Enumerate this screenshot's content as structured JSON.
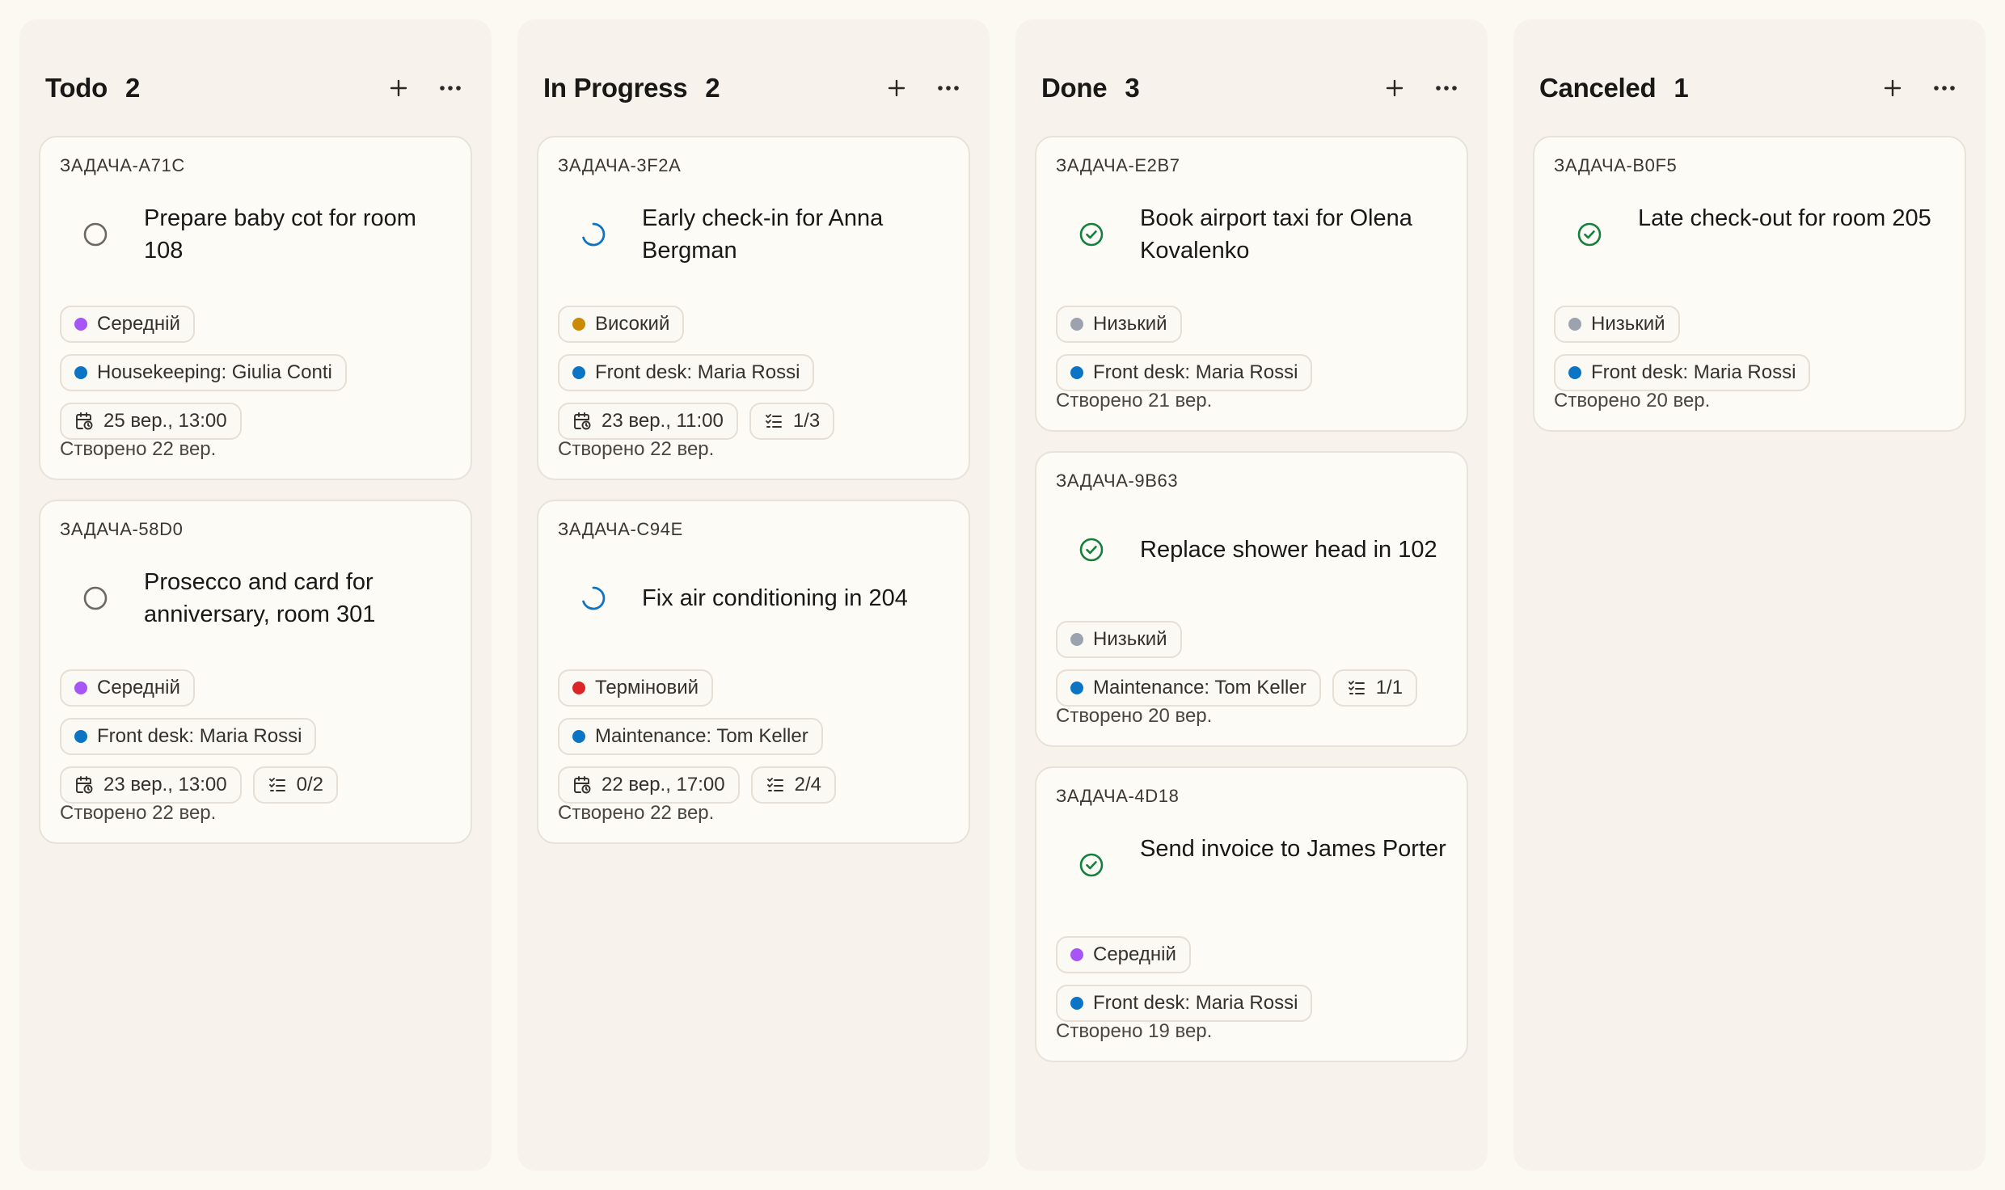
{
  "colors": {
    "background": "#fcf9f3",
    "column_bg": "#f7f3ec",
    "priority_medium": "#a855f7",
    "priority_high": "#ca8a04",
    "priority_urgent": "#dc2626",
    "priority_low": "#9ca3af",
    "assignee_dot": "#0b74c4",
    "in_progress_icon": "#0b74c4",
    "done_icon": "#15803d",
    "todo_icon": "#6b6762"
  },
  "columns": [
    {
      "title": "Todo",
      "count": "2",
      "cards": [
        {
          "id": "ЗАДАЧА-A71C",
          "status_icon": "circle-empty-icon",
          "title": "Prepare baby cot for room 108",
          "priority": "Середній",
          "assignee": "Housekeeping: Giulia Conti",
          "due": "25 вер., 13:00",
          "subtasks": "",
          "created": "Створено 22 вер."
        },
        {
          "id": "ЗАДАЧА-58D0",
          "status_icon": "circle-empty-icon",
          "title": "Prosecco and card for anniversary, room 301",
          "priority": "Середній",
          "assignee": "Front desk: Maria Rossi",
          "due": "23 вер., 13:00",
          "subtasks": "0/2",
          "created": "Створено 22 вер."
        }
      ]
    },
    {
      "title": "In Progress",
      "count": "2",
      "cards": [
        {
          "id": "ЗАДАЧА-3F2A",
          "status_icon": "in-progress-icon",
          "title": "Early check-in for Anna Bergman",
          "priority": "Високий",
          "assignee": "Front desk: Maria Rossi",
          "due": "23 вер., 11:00",
          "subtasks": "1/3",
          "created": "Створено 22 вер."
        },
        {
          "id": "ЗАДАЧА-C94E",
          "status_icon": "in-progress-icon",
          "title": "Fix air conditioning in 204",
          "priority": "Терміновий",
          "assignee": "Maintenance: Tom Keller",
          "due": "22 вер., 17:00",
          "subtasks": "2/4",
          "created": "Створено 22 вер."
        }
      ]
    },
    {
      "title": "Done",
      "count": "3",
      "cards": [
        {
          "id": "ЗАДАЧА-E2B7",
          "status_icon": "check-circle-icon",
          "title": "Book airport taxi for Olena Kovalenko",
          "priority": "Низький",
          "assignee": "Front desk: Maria Rossi",
          "due": "",
          "subtasks": "",
          "created": "Створено 21 вер."
        },
        {
          "id": "ЗАДАЧА-9B63",
          "status_icon": "check-circle-icon",
          "title": "Replace shower head in 102",
          "priority": "Низький",
          "assignee": "Maintenance: Tom Keller",
          "due": "",
          "subtasks": "1/1",
          "created": "Створено 20 вер."
        },
        {
          "id": "ЗАДАЧА-4D18",
          "status_icon": "check-circle-icon",
          "title": "Send invoice to James Porter",
          "priority": "Середній",
          "assignee": "Front desk: Maria Rossi",
          "due": "",
          "subtasks": "",
          "created": "Створено 19 вер."
        }
      ]
    },
    {
      "title": "Canceled",
      "count": "1",
      "cards": [
        {
          "id": "ЗАДАЧА-B0F5",
          "status_icon": "check-circle-icon",
          "title": "Late check-out for room 205",
          "priority": "Низький",
          "assignee": "Front desk: Maria Rossi",
          "due": "",
          "subtasks": "",
          "created": "Створено 20 вер."
        }
      ]
    }
  ]
}
